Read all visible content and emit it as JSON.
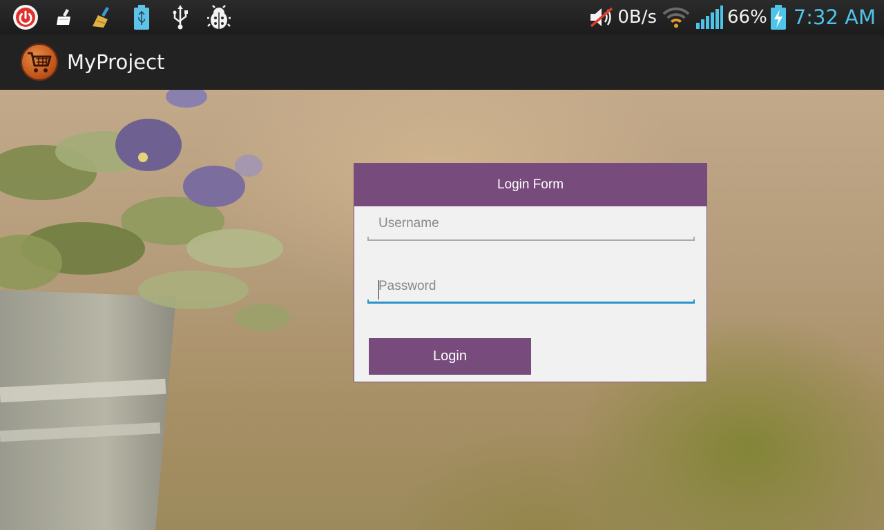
{
  "status_bar": {
    "left_icons": [
      "power-icon",
      "cleaner-icon",
      "broom-icon",
      "usb-battery-icon",
      "usb-icon",
      "bug-icon"
    ],
    "volume_icon": "muted-speaker-icon",
    "net_speed": "0B/s",
    "wifi_icon": "wifi-icon",
    "signal_icon": "signal-bars-icon",
    "battery_percent": "66%",
    "battery_icon": "battery-charging-icon",
    "time": "7:32 AM",
    "accent_color": "#4fc3e8"
  },
  "action_bar": {
    "app_icon": "shopping-cart-icon",
    "title": "MyProject"
  },
  "login_form": {
    "title": "Login Form",
    "username": {
      "placeholder": "Username",
      "value": ""
    },
    "password": {
      "placeholder": "Password",
      "value": "",
      "focused": true
    },
    "login_button": "Login",
    "accent_color": "#774c7c",
    "focus_color": "#2a93c9"
  }
}
